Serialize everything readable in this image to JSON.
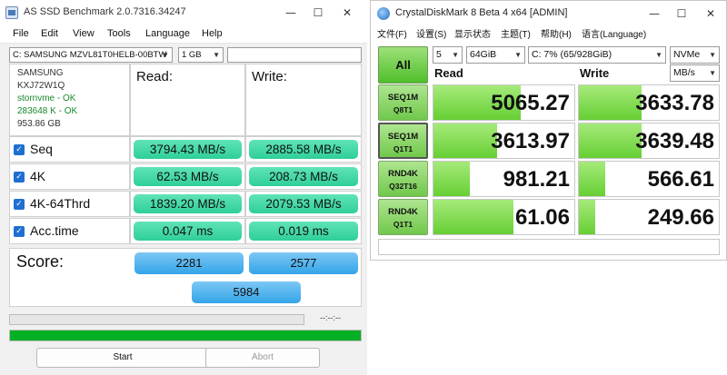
{
  "asssd": {
    "title": "AS SSD Benchmark 2.0.7316.34247",
    "window_buttons": {
      "minimize": "—",
      "maximize": "☐",
      "close": "✕"
    },
    "menu": [
      "File",
      "Edit",
      "View",
      "Tools",
      "Language",
      "Help"
    ],
    "drive_select": "C: SAMSUNG MZVL81T0HELB-00BTW",
    "size_select": "1 GB",
    "drive_info": {
      "vendor": "SAMSUNG",
      "model": "KXJ72W1Q",
      "driver": "stornvme - OK",
      "alignment": "283648 K - OK",
      "capacity": "953.86 GB"
    },
    "headers": {
      "read": "Read:",
      "write": "Write:"
    },
    "rows": [
      {
        "label": "Seq",
        "read": "3794.43 MB/s",
        "write": "2885.58 MB/s"
      },
      {
        "label": "4K",
        "read": "62.53 MB/s",
        "write": "208.73 MB/s"
      },
      {
        "label": "4K-64Thrd",
        "read": "1839.20 MB/s",
        "write": "2079.53 MB/s"
      },
      {
        "label": "Acc.time",
        "read": "0.047 ms",
        "write": "0.019 ms"
      }
    ],
    "score": {
      "label": "Score:",
      "read": "2281",
      "write": "2577",
      "total": "5984"
    },
    "progress": {
      "time": "--:--:--",
      "fraction": 1.0
    },
    "buttons": {
      "start": "Start",
      "abort": "Abort"
    },
    "colors": {
      "result_green": "#2fcf98",
      "score_blue": "#33a4e8",
      "progress_green": "#06b025"
    }
  },
  "cdm": {
    "title": "CrystalDiskMark 8 Beta 4 x64 [ADMIN]",
    "window_buttons": {
      "minimize": "—",
      "maximize": "☐",
      "close": "✕"
    },
    "menu": [
      "文件(F)",
      "设置(S)",
      "显示状态",
      "主题(T)",
      "帮助(H)",
      "语言(Language)"
    ],
    "all_button": "All",
    "count": "5",
    "size": "64GiB",
    "drive": "C: 7% (65/928GiB)",
    "mode": "NVMe",
    "unit": "MB/s",
    "headers": {
      "read": "Read",
      "write": "Write"
    },
    "tests": [
      {
        "line1": "SEQ1M",
        "line2": "Q8T1",
        "read": "5065.27",
        "write": "3633.78",
        "read_fill": 0.62,
        "write_fill": 0.45
      },
      {
        "line1": "SEQ1M",
        "line2": "Q1T1",
        "read": "3613.97",
        "write": "3639.48",
        "read_fill": 0.45,
        "write_fill": 0.45
      },
      {
        "line1": "RND4K",
        "line2": "Q32T16",
        "read": "981.21",
        "write": "566.61",
        "read_fill": 0.26,
        "write_fill": 0.19
      },
      {
        "line1": "RND4K",
        "line2": "Q1T1",
        "read": "61.06",
        "write": "249.66",
        "read_fill": 0.57,
        "write_fill": 0.12
      }
    ],
    "colors": {
      "bar_green": "#66cf34",
      "button_green": "#70c84b"
    }
  }
}
